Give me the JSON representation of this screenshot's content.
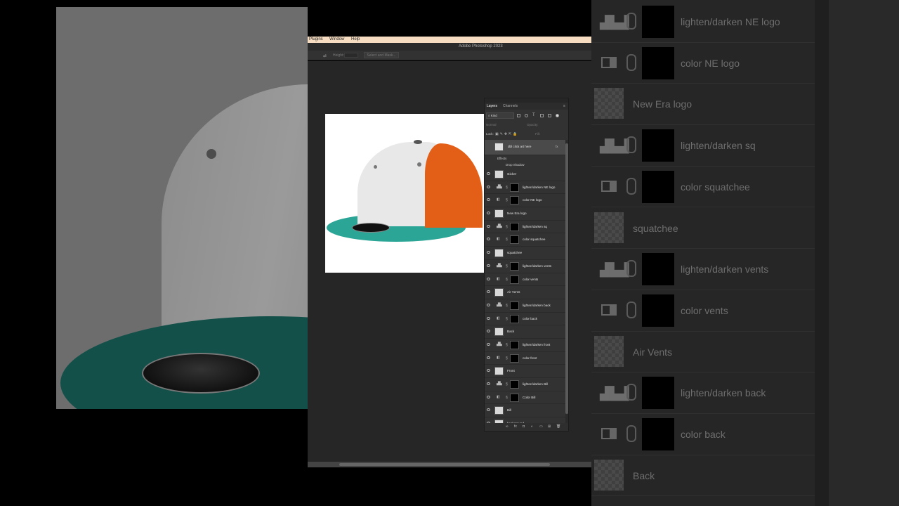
{
  "menu": {
    "items": [
      "Plugins",
      "Window",
      "Help"
    ]
  },
  "app_title": "Adobe Photoshop 2023",
  "options_bar": {
    "height_label": "Height:",
    "select_mask": "Select and Mask..."
  },
  "layers_panel": {
    "tabs": [
      "Layers",
      "Channels"
    ],
    "filter_label": "Kind",
    "blend_mode": "Normal",
    "opacity_label": "Opacity:",
    "lock_label": "Lock:",
    "fill_label": "Fill:",
    "selected_layer": "dbl click art here",
    "fx_label": "fx",
    "effects_label": "Effects",
    "drop_shadow_label": "Drop Shadow",
    "layers": [
      {
        "name": "sticker",
        "kind": "pixel"
      },
      {
        "name": "lighten/darken NE logo",
        "kind": "levels"
      },
      {
        "name": "color NE logo",
        "kind": "color"
      },
      {
        "name": "New Era logo",
        "kind": "pixel"
      },
      {
        "name": "lighten/darken sq",
        "kind": "levels"
      },
      {
        "name": "color squatchee",
        "kind": "color"
      },
      {
        "name": "squatchee",
        "kind": "pixel"
      },
      {
        "name": "lighten/darken vents",
        "kind": "levels"
      },
      {
        "name": "color vents",
        "kind": "color"
      },
      {
        "name": "Air  Vents",
        "kind": "pixel"
      },
      {
        "name": "lighten/darken back",
        "kind": "levels"
      },
      {
        "name": "color back",
        "kind": "color"
      },
      {
        "name": "Back",
        "kind": "pixel"
      },
      {
        "name": "lighten/darken front",
        "kind": "levels"
      },
      {
        "name": "color front",
        "kind": "color"
      },
      {
        "name": "Front",
        "kind": "pixel"
      },
      {
        "name": "lighten/darken Bill",
        "kind": "levels"
      },
      {
        "name": "Color Bill",
        "kind": "color"
      },
      {
        "name": "Bill",
        "kind": "pixel"
      },
      {
        "name": "background",
        "kind": "pixel"
      }
    ],
    "footer_icons": [
      "link-icon",
      "fx-icon",
      "mask-icon",
      "adjustment-icon",
      "folder-icon",
      "new-layer-icon",
      "trash-icon"
    ]
  },
  "zoom_panel": {
    "rows": [
      {
        "name": "lighten/darken NE logo",
        "kind": "levels"
      },
      {
        "name": "color NE logo",
        "kind": "color"
      },
      {
        "name": "New Era logo",
        "kind": "pixel"
      },
      {
        "name": "lighten/darken sq",
        "kind": "levels"
      },
      {
        "name": "color squatchee",
        "kind": "color"
      },
      {
        "name": "squatchee",
        "kind": "pixel"
      },
      {
        "name": "lighten/darken vents",
        "kind": "levels"
      },
      {
        "name": "color vents",
        "kind": "color"
      },
      {
        "name": "Air  Vents",
        "kind": "pixel"
      },
      {
        "name": "lighten/darken back",
        "kind": "levels"
      },
      {
        "name": "color back",
        "kind": "color"
      },
      {
        "name": "Back",
        "kind": "pixel"
      }
    ]
  },
  "colors": {
    "cap_white": "#e8e8e8",
    "cap_orange": "#e35f17",
    "cap_teal": "#2aa596",
    "menubar": "#f6dcc0",
    "workspace": "#262626"
  }
}
